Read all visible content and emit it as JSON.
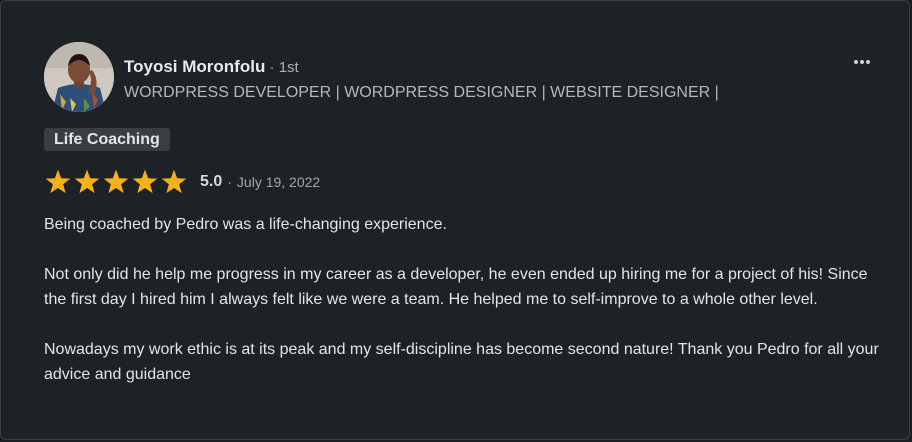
{
  "review": {
    "author": {
      "name": "Toyosi Moronfolu",
      "separator": " · ",
      "degree": "1st",
      "headline": "WORDPRESS DEVELOPER | WORDPRESS DESIGNER | WEBSITE DESIGNER |"
    },
    "menu_icon": "more-horizontal-icon",
    "tag": "Life Coaching",
    "rating": {
      "stars": 5,
      "max_stars": 5,
      "score": "5.0",
      "separator": "·",
      "date": "July 19, 2022",
      "star_color": "#f5b11d"
    },
    "paragraphs": [
      "Being coached by Pedro was a life-changing experience.",
      "Not only did he help me progress in my career as a developer, he even ended up hiring me for a project of his! Since the first day I hired him I always felt like we were a team. He helped me to self-improve to a whole other level.",
      "Nowadays my work ethic is at its peak and my self-discipline has become second nature! Thank you Pedro for all your advice and guidance"
    ]
  }
}
